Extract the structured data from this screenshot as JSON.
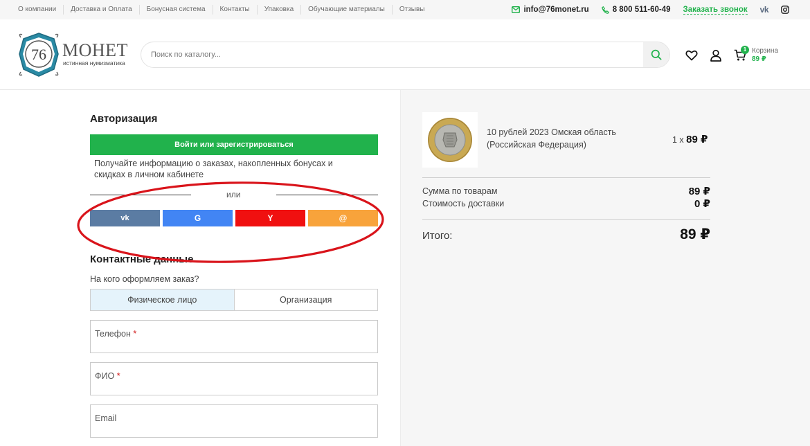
{
  "topnav": [
    "О компании",
    "Доставка и Оплата",
    "Бонусная система",
    "Контакты",
    "Упаковка",
    "Обучающие материалы",
    "Отзывы"
  ],
  "contacts": {
    "email": "info@76monet.ru",
    "phone": "8 800 511-60-49",
    "callback": "Заказать звонок",
    "vk": "vk"
  },
  "logo": {
    "number": "76",
    "name": "МОНЕТ",
    "tagline": "истинная нумизматика"
  },
  "search": {
    "placeholder": "Поиск по каталогу..."
  },
  "cart": {
    "count": "1",
    "label": "Корзина",
    "sum": "89 ₽"
  },
  "auth": {
    "title": "Авторизация",
    "login_button": "Войти или зарегистрироваться",
    "hint": "Получайте информацию о заказах, накопленных бонусах и скидках в личном кабинете",
    "or": "или",
    "social": [
      {
        "name": "vk",
        "label": "vk",
        "color": "#5b7ca3"
      },
      {
        "name": "google",
        "label": "G",
        "color": "#4285f4"
      },
      {
        "name": "yandex",
        "label": "Y",
        "color": "#f01010"
      },
      {
        "name": "mail",
        "label": "@",
        "color": "#f8a33b"
      }
    ]
  },
  "contact": {
    "title": "Контактные данные",
    "question": "На кого оформляем заказ?",
    "person": "Физическое лицо",
    "org": "Организация",
    "phone_label": "Телефон",
    "name_label": "ФИО",
    "email_label": "Email",
    "required_mark": "*"
  },
  "summary": {
    "product_name": "10 рублей 2023 Омская область (Российская Федерация)",
    "qty": "1 x",
    "price": "89 ₽",
    "goods_label": "Сумма по товарам",
    "goods_value": "89 ₽",
    "delivery_label": "Стоимость доставки",
    "delivery_value": "0 ₽",
    "total_label": "Итого:",
    "total_value": "89 ₽"
  },
  "colors": {
    "accent": "#21b24c",
    "annotation": "#d9141b"
  }
}
